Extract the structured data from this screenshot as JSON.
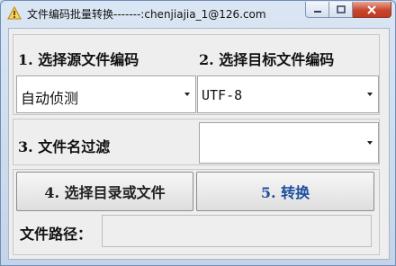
{
  "window": {
    "title": "文件编码批量转换-------:chenjiajia_1@126.com",
    "controls": {
      "minimize": "minimize-icon",
      "maximize": "maximize-icon",
      "close": "close-icon"
    }
  },
  "source": {
    "label": "1. 选择源文件编码",
    "selected": "自动侦测"
  },
  "target": {
    "label": "2. 选择目标文件编码",
    "selected": "UTF-8"
  },
  "filter": {
    "label": "3. 文件名过滤",
    "selected": ""
  },
  "buttons": {
    "choose": "4. 选择目录或文件",
    "convert": "5. 转换"
  },
  "path": {
    "label": "文件路径：",
    "value": ""
  },
  "colors": {
    "convert_text": "#1d4f9f",
    "close_button": "#c7472e"
  }
}
